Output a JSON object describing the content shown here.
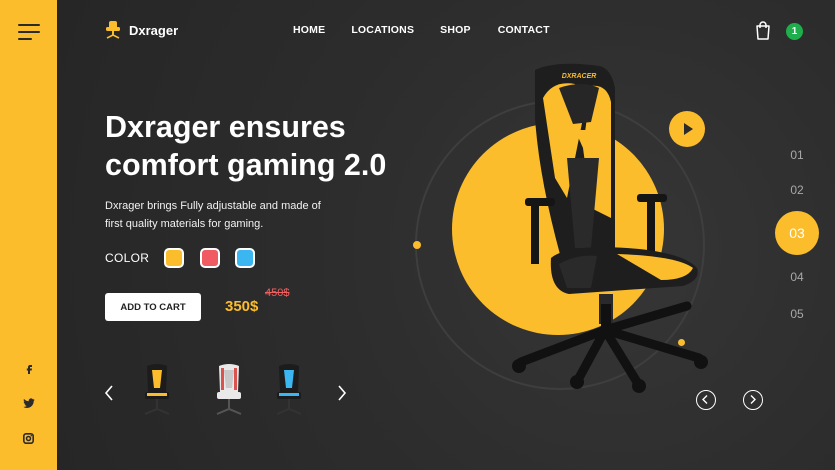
{
  "brand": {
    "name": "Dxrager",
    "accent": "#fbbd2c"
  },
  "nav": {
    "items": [
      {
        "label": "HOME"
      },
      {
        "label": "LOCATIONS"
      },
      {
        "label": "SHOP"
      },
      {
        "label": "CONTACT"
      }
    ]
  },
  "cart": {
    "count": "1",
    "icon": "shopping-bag-icon"
  },
  "hero": {
    "headline_line1": "Dxrager ensures",
    "headline_line2": "comfort gaming 2.0",
    "subtext_line1": "Dxrager brings Fully adjustable and made of",
    "subtext_line2": "first quality materials for gaming."
  },
  "color": {
    "label": "COLOR",
    "options": [
      {
        "name": "yellow",
        "hex": "#fbbd2c"
      },
      {
        "name": "red",
        "hex": "#ef5a63"
      },
      {
        "name": "blue",
        "hex": "#3cb6f0"
      }
    ]
  },
  "product": {
    "add_to_cart_label": "ADD TO CART",
    "old_price": "450$",
    "new_price": "350$",
    "chair_logo": "DXRACER"
  },
  "thumbnails": [
    {
      "name": "yellow-chair",
      "color": "#fbbd2c"
    },
    {
      "name": "white-red-chair",
      "color": "#e9e9e9"
    },
    {
      "name": "blue-chair",
      "color": "#3cb6f0"
    }
  ],
  "pagination": {
    "pages": [
      "01",
      "02",
      "03",
      "04",
      "05"
    ],
    "active": "03"
  },
  "social": [
    "facebook-icon",
    "twitter-icon",
    "instagram-icon"
  ],
  "social_glyphs": {
    "facebook": "f",
    "twitter": "t",
    "instagram": "◎"
  }
}
